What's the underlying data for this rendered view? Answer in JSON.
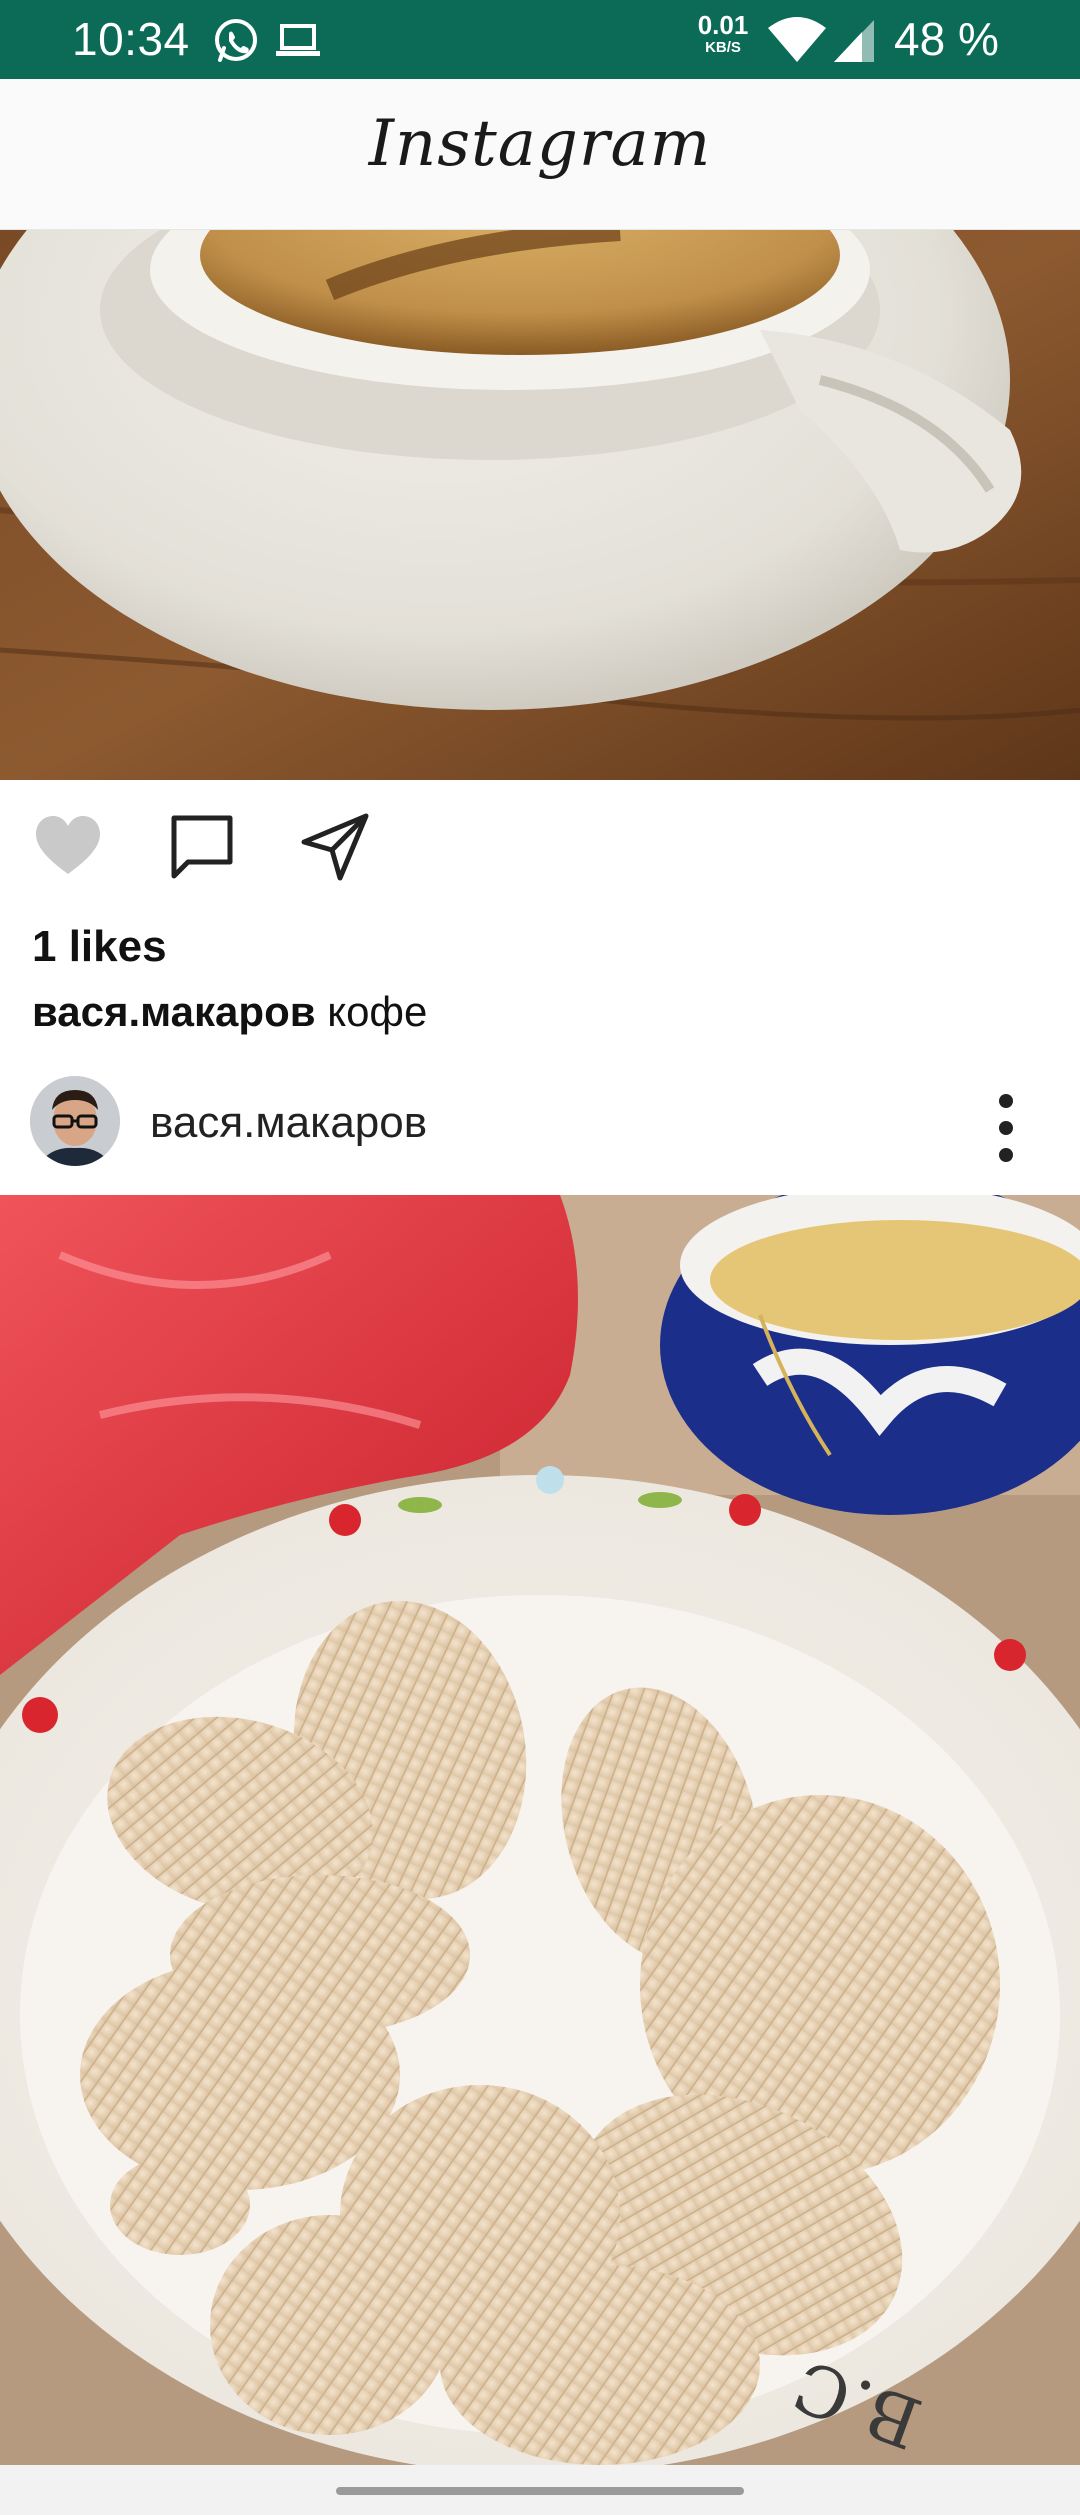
{
  "status_bar": {
    "time": "10:34",
    "speed_value": "0.01",
    "speed_unit": "KB/S",
    "battery": "48 %",
    "icons": [
      "whatsapp-icon",
      "laptop-icon",
      "wifi-icon",
      "signal-icon"
    ],
    "background_color": "#0b6b57"
  },
  "app_bar": {
    "title": "Instagram"
  },
  "post_1": {
    "image": "coffee-cup-photo",
    "likes": "1 likes",
    "caption_user": "вася.макаров",
    "caption_text": "кофе"
  },
  "post_2": {
    "username": "вася.макаров",
    "image": "chips-bowl-photo"
  },
  "actions": {
    "icons": [
      "heart-icon",
      "comment-icon",
      "share-icon"
    ]
  }
}
